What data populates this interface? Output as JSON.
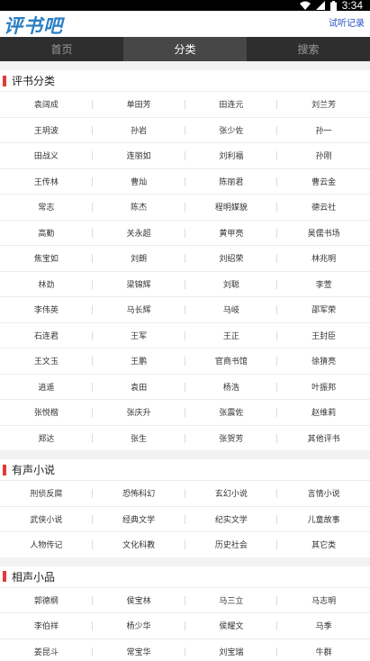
{
  "status": {
    "time": "3:34"
  },
  "app": {
    "logo": "评书吧",
    "history_link": "试听记录"
  },
  "tabs": [
    {
      "label": "首页"
    },
    {
      "label": "分类"
    },
    {
      "label": "搜索"
    }
  ],
  "sections": [
    {
      "title": "评书分类",
      "items": [
        "袁阔成",
        "单田芳",
        "田连元",
        "刘兰芳",
        "王玥波",
        "孙岩",
        "张少佐",
        "孙一",
        "田战义",
        "连丽如",
        "刘利福",
        "孙刚",
        "王传林",
        "曹灿",
        "陈丽君",
        "曹云金",
        "常志",
        "陈杰",
        "程明媒貌",
        "德云社",
        "高勤",
        "关永超",
        "黄甲亮",
        "昊儒书场",
        "焦宝如",
        "刘朗",
        "刘绍荣",
        "林兆明",
        "林劲",
        "梁锦辉",
        "刘聪",
        "李萱",
        "李伟英",
        "马长辉",
        "马岐",
        "邵军荣",
        "石连君",
        "王军",
        "王正",
        "王封臣",
        "王文玉",
        "王鹏",
        "官商书馆",
        "徐猜亮",
        "逍遥",
        "袁田",
        "杨浩",
        "叶振邦",
        "张悦楷",
        "张庆升",
        "张震佐",
        "赵维莉",
        "郑达",
        "张生",
        "张贺芳",
        "其他评书"
      ]
    },
    {
      "title": "有声小说",
      "items": [
        "刑侦反腐",
        "恐怖科幻",
        "玄幻小说",
        "言情小说",
        "武侠小说",
        "经典文学",
        "纪实文学",
        "儿童故事",
        "人物传记",
        "文化科教",
        "历史社会",
        "其它类"
      ]
    },
    {
      "title": "相声小品",
      "items": [
        "郭德纲",
        "侯宝林",
        "马三立",
        "马志明",
        "李伯祥",
        "杨少华",
        "侯耀文",
        "马季",
        "姜昆斗",
        "常宝华",
        "刘宝瑞",
        "牛群"
      ]
    }
  ]
}
